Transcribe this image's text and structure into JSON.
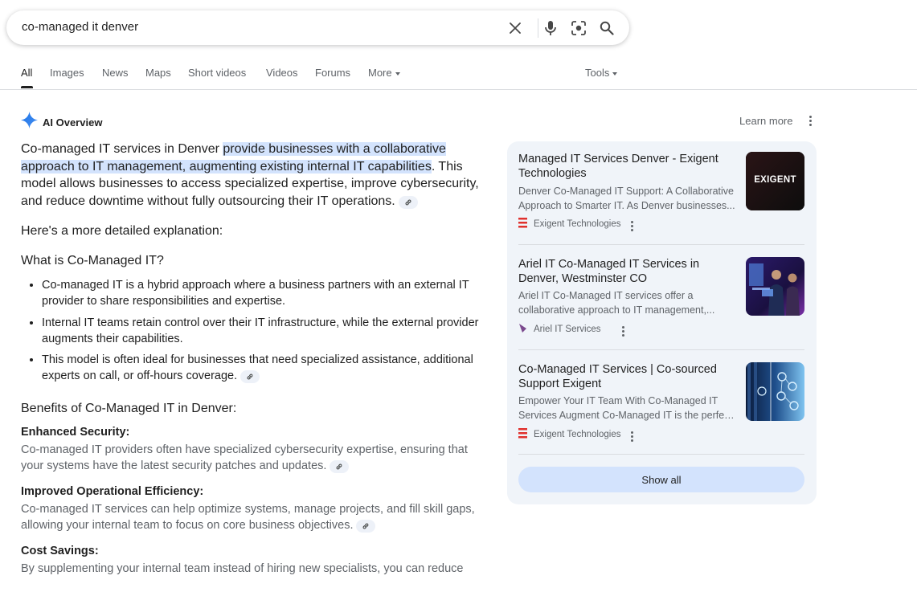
{
  "search": {
    "query": "co-managed it denver"
  },
  "tabs": [
    {
      "label": "All"
    },
    {
      "label": "Images"
    },
    {
      "label": "News"
    },
    {
      "label": "Maps"
    },
    {
      "label": "Short videos"
    },
    {
      "label": "Videos"
    },
    {
      "label": "Forums"
    },
    {
      "label": "More"
    }
  ],
  "tools_label": "Tools",
  "ai_overview": {
    "title": "AI Overview",
    "learn_more": "Learn more",
    "intro_pre": "Co-managed IT services in Denver ",
    "intro_highlight": "provide businesses with a collaborative approach to IT management, augmenting existing internal IT capabilities",
    "intro_post": ". This model allows businesses to access specialized expertise, improve cybersecurity, and reduce downtime without fully outsourcing their IT operations.",
    "detail": "Here's a more detailed explanation:",
    "section1_title": "What is Co-Managed IT?",
    "bullets": [
      "Co-managed IT is a hybrid approach where a business partners with an external IT provider to share responsibilities and expertise.",
      "Internal IT teams retain control over their IT infrastructure, while the external provider augments their capabilities.",
      "This model is often ideal for businesses that need specialized assistance, additional experts on call, or off-hours coverage."
    ],
    "section2_title": "Benefits of Co-Managed IT in Denver:",
    "benefits": [
      {
        "title": "Enhanced Security:",
        "text": "Co-managed IT providers often have specialized cybersecurity expertise, ensuring that your systems have the latest security patches and updates."
      },
      {
        "title": "Improved Operational Efficiency:",
        "text": "Co-managed IT services can help optimize systems, manage projects, and fill skill gaps, allowing your internal team to focus on core business objectives."
      },
      {
        "title": "Cost Savings:",
        "text": "By supplementing your internal team instead of hiring new specialists, you can reduce"
      }
    ]
  },
  "sources": [
    {
      "title": "Managed IT Services Denver - Exigent Technologies",
      "snippet_line1": "Denver Co-Managed IT Support: A Collaborative",
      "snippet_line2": "Approach to Smarter IT. As Denver businesses...",
      "site": "Exigent Technologies",
      "thumb_text": "EXIGENT"
    },
    {
      "title": "Ariel IT Co-Managed IT Services in Denver, Westminster CO",
      "snippet_line1": "Ariel IT Co-Managed IT services offer a",
      "snippet_line2": "collaborative approach to IT management,...",
      "site": "Ariel IT Services"
    },
    {
      "title": "Co-Managed IT Services | Co-sourced Support Exigent",
      "snippet_line1": "Empower Your IT Team With Co-Managed IT",
      "snippet_line2": "Services Augment Co-Managed IT is the perfec...",
      "site": "Exigent Technologies"
    }
  ],
  "show_all": "Show all",
  "colors": {
    "accent_blue": "#0b57d0",
    "highlight": "#d3e3fd",
    "panel_bg": "#f0f4f9",
    "exigent_red": "#e0312d"
  }
}
